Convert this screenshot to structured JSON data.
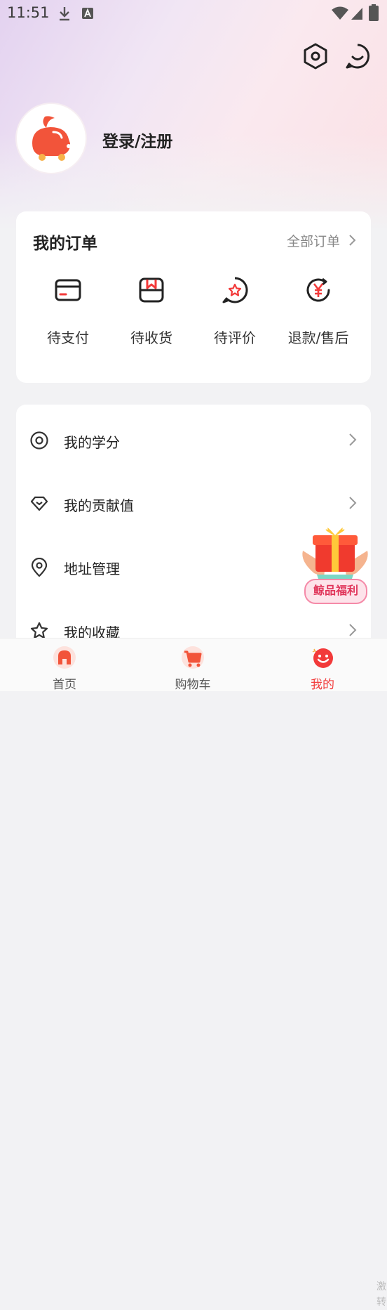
{
  "status_bar": {
    "time": "11:51"
  },
  "header": {
    "login_label": "登录/注册"
  },
  "orders": {
    "title": "我的订单",
    "all_label": "全部订单",
    "items": [
      {
        "label": "待支付",
        "icon": "wallet-icon"
      },
      {
        "label": "待收货",
        "icon": "package-icon"
      },
      {
        "label": "待评价",
        "icon": "review-star-icon"
      },
      {
        "label": "退款/售后",
        "icon": "refund-yen-icon"
      }
    ]
  },
  "menu": {
    "items": [
      {
        "label": "我的学分",
        "icon": "credit-circle-icon"
      },
      {
        "label": "我的贡献值",
        "icon": "diamond-icon"
      },
      {
        "label": "地址管理",
        "icon": "location-pin-icon"
      },
      {
        "label": "我的收藏",
        "icon": "star-icon"
      }
    ]
  },
  "promo": {
    "label": "鲸品福利"
  },
  "tabbar": {
    "items": [
      {
        "label": "首页",
        "icon": "home-icon"
      },
      {
        "label": "购物车",
        "icon": "cart-icon"
      },
      {
        "label": "我的",
        "icon": "smiley-icon",
        "active": true
      }
    ]
  },
  "edge_text": {
    "line1": "激",
    "line2": "转"
  },
  "colors": {
    "accent": "#f23a3a",
    "brand": "#f0543a"
  }
}
